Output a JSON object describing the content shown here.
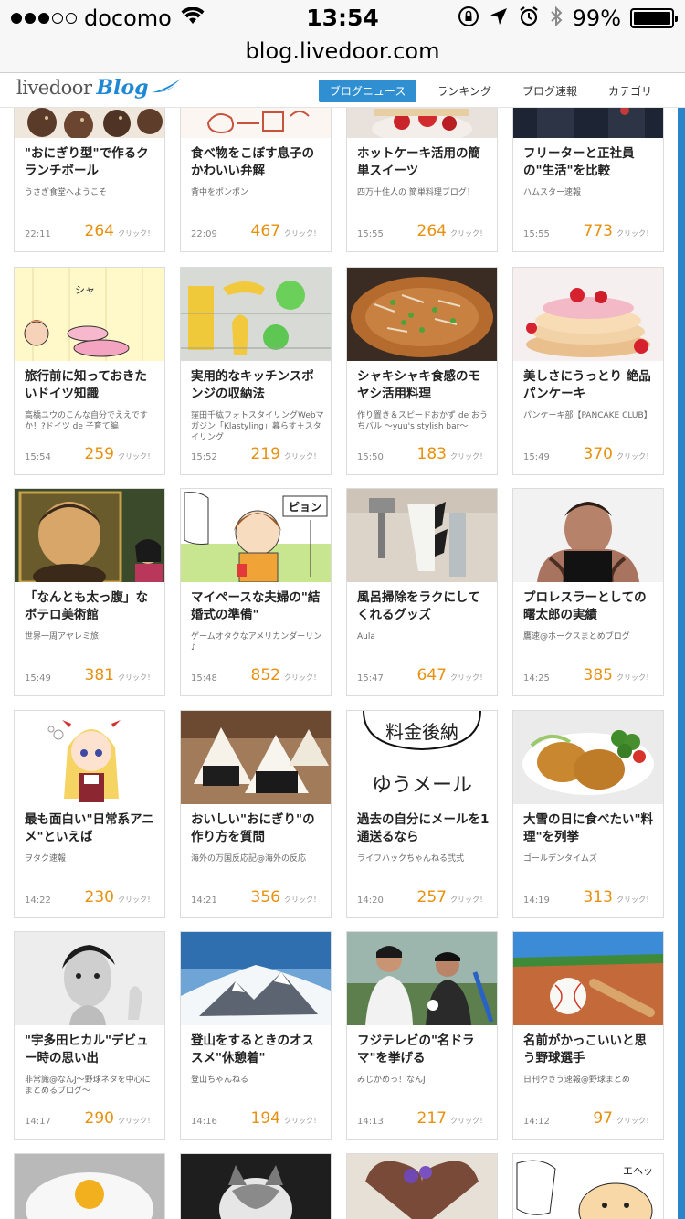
{
  "status_bar": {
    "carrier": "docomo",
    "time": "13:54",
    "battery_percent": "99%",
    "battery_level": 0.99
  },
  "browser": {
    "url": "blog.livedoor.com"
  },
  "header": {
    "logo_text": "livedoor",
    "logo_blog": "Blog",
    "nav": [
      "ブログニュース",
      "ランキング",
      "ブログ速報",
      "カテゴリ"
    ],
    "active_nav": 0
  },
  "click_label": "クリック！",
  "cards": [
    {
      "title": "\"おにぎり型\"で作るクランチボール",
      "source": "うさぎ食堂へようこそ",
      "time": "22:11",
      "count": "264"
    },
    {
      "title": "食べ物をこぼす息子のかわいい弁解",
      "source": "背中をポンポン",
      "time": "22:09",
      "count": "467"
    },
    {
      "title": "ホットケーキ活用の簡単スイーツ",
      "source": "四万十住人の 簡単料理ブログ！",
      "time": "15:55",
      "count": "264"
    },
    {
      "title": "フリーターと正社員の\"生活\"を比較",
      "source": "ハムスター速報",
      "time": "15:55",
      "count": "773"
    },
    {
      "title": "旅行前に知っておきたいドイツ知識",
      "source": "高橋ユウのこんな自分でええですか！?ドイツ de 子育て編",
      "time": "15:54",
      "count": "259"
    },
    {
      "title": "実用的なキッチンスポンジの収納法",
      "source": "窪田千紘フォトスタイリングWebマガジン「Klastyling」暮らす＋スタイリング",
      "time": "15:52",
      "count": "219"
    },
    {
      "title": "シャキシャキ食感のモヤシ活用料理",
      "source": "作り置き＆スピードおかず de おうちバル 〜yuu's stylish bar〜",
      "time": "15:50",
      "count": "183"
    },
    {
      "title": "美しさにうっとり 絶品パンケーキ",
      "source": "パンケーキ部【PANCAKE CLUB】",
      "time": "15:49",
      "count": "370"
    },
    {
      "title": "「なんとも太っ腹」なボテロ美術館",
      "source": "世界一周アヤレミ旅",
      "time": "15:49",
      "count": "381"
    },
    {
      "title": "マイペースな夫婦の\"結婚式の準備\"",
      "source": "ゲームオタクなアメリカンダーリン♪",
      "time": "15:48",
      "count": "852"
    },
    {
      "title": "風呂掃除をラクにしてくれるグッズ",
      "source": "Aula",
      "time": "15:47",
      "count": "647"
    },
    {
      "title": "プロレスラーとしての曙太郎の実績",
      "source": "鷹速@ホークスまとめブログ",
      "time": "14:25",
      "count": "385"
    },
    {
      "title": "最も面白い\"日常系アニメ\"といえば",
      "source": "ヲタク速報",
      "time": "14:22",
      "count": "230"
    },
    {
      "title": "おいしい\"おにぎり\"の作り方を質問",
      "source": "海外の万国反応記@海外の反応",
      "time": "14:21",
      "count": "356"
    },
    {
      "title": "過去の自分にメールを1通送るなら",
      "source": "ライフハックちゃんねる弐式",
      "time": "14:20",
      "count": "257"
    },
    {
      "title": "大雪の日に食べたい\"料理\"を列挙",
      "source": "ゴールデンタイムズ",
      "time": "14:19",
      "count": "313"
    },
    {
      "title": "\"宇多田ヒカル\"デビュー時の思い出",
      "source": "非常識@なんJ〜野球ネタを中心にまとめるブログ〜",
      "time": "14:17",
      "count": "290"
    },
    {
      "title": "登山をするときのオススメ\"休憩着\"",
      "source": "登山ちゃんねる",
      "time": "14:16",
      "count": "194"
    },
    {
      "title": "フジテレビの\"名ドラマ\"を挙げる",
      "source": "みじかめっ！なんJ",
      "time": "14:13",
      "count": "217"
    },
    {
      "title": "名前がかっこいいと思う野球選手",
      "source": "日刊やきう速報@野球まとめ",
      "time": "14:12",
      "count": "97"
    }
  ],
  "thumb_text": {
    "yupack_top": "料金後納",
    "yupack_bottom": "ゆうメール",
    "piyon": "ピョン",
    "eheh": "エヘッ"
  }
}
